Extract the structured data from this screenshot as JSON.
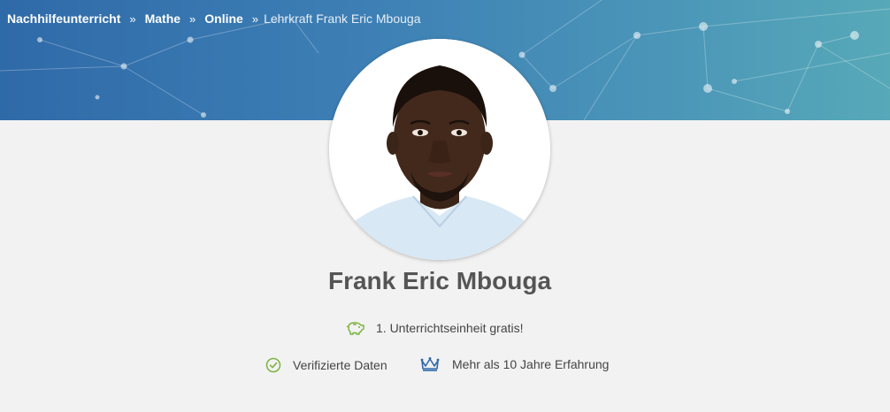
{
  "breadcrumb": {
    "items": [
      "Nachhilfeunterricht",
      "Mathe",
      "Online"
    ],
    "separator": "»",
    "current": "Lehrkraft Frank Eric Mbouga"
  },
  "profile": {
    "name": "Frank Eric Mbouga",
    "avatar_alt": "Frank Eric Mbouga"
  },
  "features": {
    "free_lesson": "1. Unterrichtseinheit gratis!",
    "verified": "Verifizierte Daten",
    "experience": "Mehr als 10 Jahre Erfahrung"
  },
  "colors": {
    "banner_start": "#2f6aa8",
    "banner_end": "#57a9b8",
    "accent_green": "#7cb342",
    "accent_blue": "#2f6aa8"
  },
  "icons": {
    "free_lesson": "piggy-bank-icon",
    "verified": "check-circle-icon",
    "experience": "crown-icon"
  }
}
